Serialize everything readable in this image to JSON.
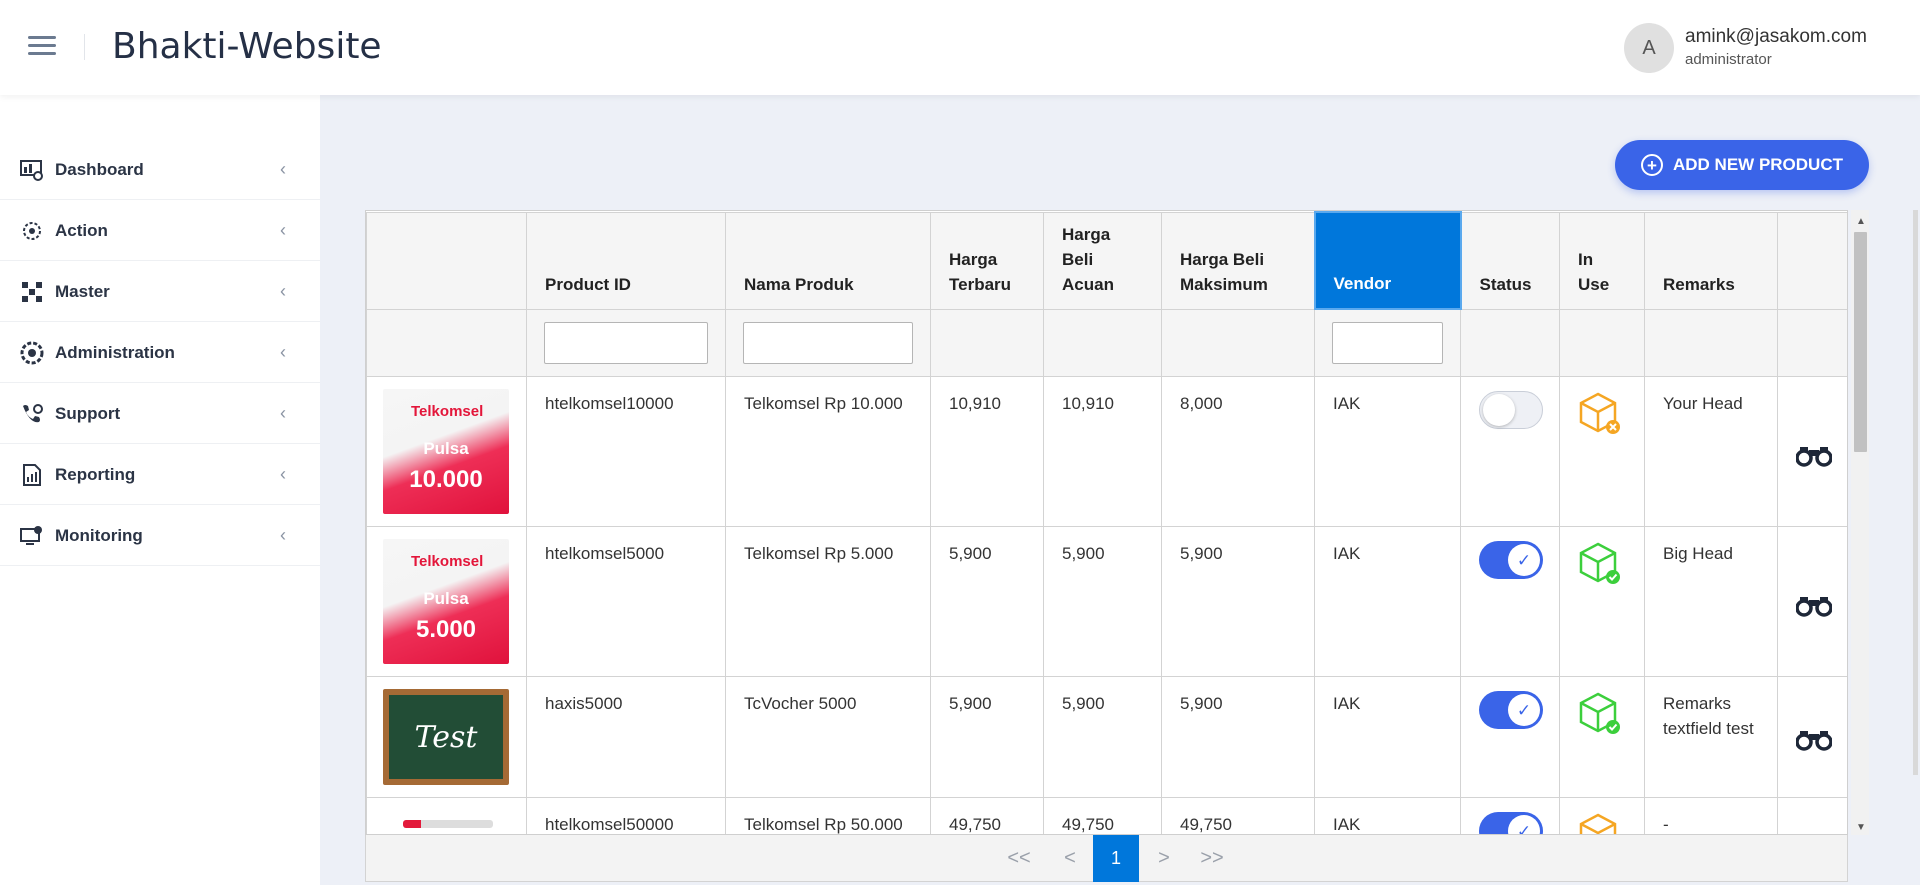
{
  "header": {
    "title": "Bhakti-Website",
    "avatar_letter": "A",
    "user_email": "amink@jasakom.com",
    "user_role": "administrator"
  },
  "sidebar": {
    "items": [
      {
        "label": "Dashboard",
        "icon": "dashboard-icon"
      },
      {
        "label": "Action",
        "icon": "action-icon"
      },
      {
        "label": "Master",
        "icon": "master-icon"
      },
      {
        "label": "Administration",
        "icon": "administration-icon"
      },
      {
        "label": "Support",
        "icon": "support-icon"
      },
      {
        "label": "Reporting",
        "icon": "reporting-icon"
      },
      {
        "label": "Monitoring",
        "icon": "monitoring-icon"
      }
    ]
  },
  "toolbar": {
    "add_label": "ADD NEW PRODUCT"
  },
  "table": {
    "columns": [
      "",
      "Product ID",
      "Nama Produk",
      "Harga Terbaru",
      "Harga Beli Acuan",
      "Harga Beli Maksimum",
      "Vendor",
      "Status",
      "In Use",
      "Remarks",
      ""
    ],
    "rows": [
      {
        "image": {
          "brand": "Telkomsel",
          "word": "Pulsa",
          "amount": "10.000"
        },
        "product_id": "htelkomsel10000",
        "nama_produk": "Telkomsel Rp 10.000",
        "harga_terbaru": "10,910",
        "harga_beli_acuan": "10,910",
        "harga_beli_maksimum": "8,000",
        "vendor": "IAK",
        "status": "off",
        "in_use": "not-in-use",
        "remarks": "Your Head"
      },
      {
        "image": {
          "brand": "Telkomsel",
          "word": "Pulsa",
          "amount": "5.000"
        },
        "product_id": "htelkomsel5000",
        "nama_produk": "Telkomsel Rp 5.000",
        "harga_terbaru": "5,900",
        "harga_beli_acuan": "5,900",
        "harga_beli_maksimum": "5,900",
        "vendor": "IAK",
        "status": "on",
        "in_use": "in-use",
        "remarks": "Big Head"
      },
      {
        "image": {
          "board_text": "Test"
        },
        "product_id": "haxis5000",
        "nama_produk": "TcVocher 5000",
        "harga_terbaru": "5,900",
        "harga_beli_acuan": "5,900",
        "harga_beli_maksimum": "5,900",
        "vendor": "IAK",
        "status": "on",
        "in_use": "in-use",
        "remarks": "Remarks textfield test"
      },
      {
        "image": {},
        "product_id": "htelkomsel50000",
        "nama_produk": "Telkomsel Rp 50.000",
        "harga_terbaru": "49,750",
        "harga_beli_acuan": "49,750",
        "harga_beli_maksimum": "49,750",
        "vendor": "IAK",
        "status": "on",
        "in_use": "not-in-use",
        "remarks": "-"
      }
    ]
  },
  "pagination": {
    "first": "<<",
    "prev": "<",
    "current": "1",
    "next": ">",
    "last": ">>"
  },
  "colors": {
    "accent": "#3a64e8",
    "vendor_header": "#0077db",
    "in_use_green": "#3ccf3c",
    "not_in_use_orange": "#f5a623"
  }
}
